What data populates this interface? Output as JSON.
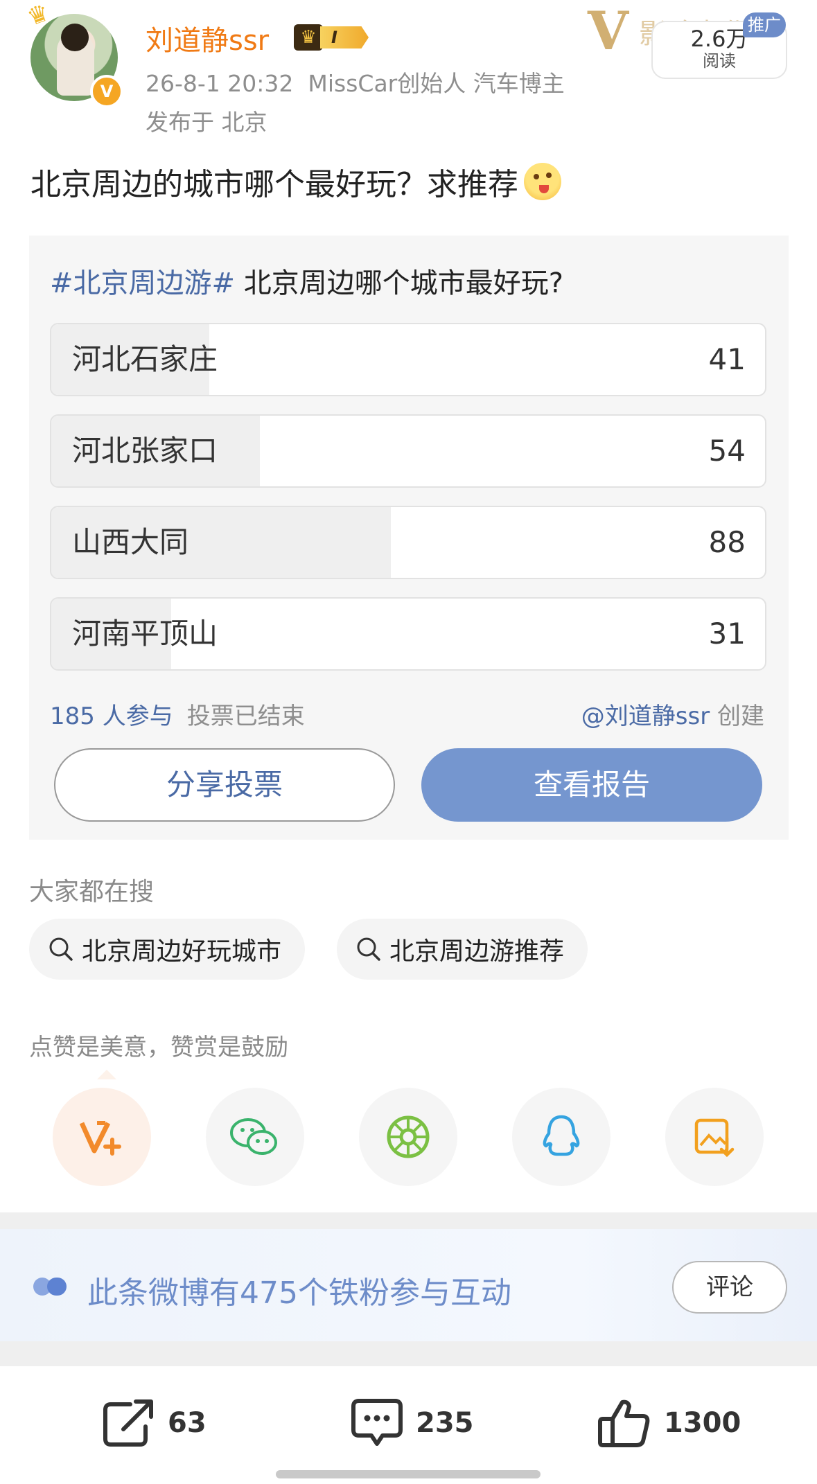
{
  "header": {
    "username": "刘道静ssr",
    "level": "I",
    "timestamp": "26-8-1 20:32",
    "author_title": "MissCar创始人 汽车博主",
    "location": "发布于 北京",
    "promo_tag": "推广",
    "views": "2.6万",
    "views_label": "阅读",
    "watermark_text": "影响力作者"
  },
  "post": {
    "text": "北京周边的城市哪个最好玩？求推荐"
  },
  "poll": {
    "hashtag": "#北京周边游#",
    "question": " 北京周边哪个城市最好玩?",
    "options": [
      {
        "label": "河北石家庄",
        "votes": "41",
        "share": 0.2216
      },
      {
        "label": "河北张家口",
        "votes": "54",
        "share": 0.2919
      },
      {
        "label": "山西大同",
        "votes": "88",
        "share": 0.4757
      },
      {
        "label": "河南平顶山",
        "votes": "31",
        "share": 0.1676
      }
    ],
    "participants": "185 人参与",
    "status": "投票已结束",
    "creator": "@刘道静ssr",
    "created": " 创建",
    "share_button": "分享投票",
    "report_button": "查看报告"
  },
  "search": {
    "title": "大家都在搜",
    "chips": [
      "北京周边好玩城市",
      "北京周边游推荐"
    ]
  },
  "reward": {
    "title": "点赞是美意，赞赏是鼓励",
    "buttons": [
      "weibo-reward-icon",
      "wechat-icon",
      "moments-icon",
      "qq-icon",
      "save-image-icon"
    ]
  },
  "fans": {
    "text": "此条微博有475个铁粉参与互动",
    "comment_button": "评论"
  },
  "actions": {
    "repost": "63",
    "comment": "235",
    "like": "1300"
  },
  "colors": {
    "accent": "#7596cf",
    "link": "#4a6aa5",
    "username": "#f07a14"
  }
}
